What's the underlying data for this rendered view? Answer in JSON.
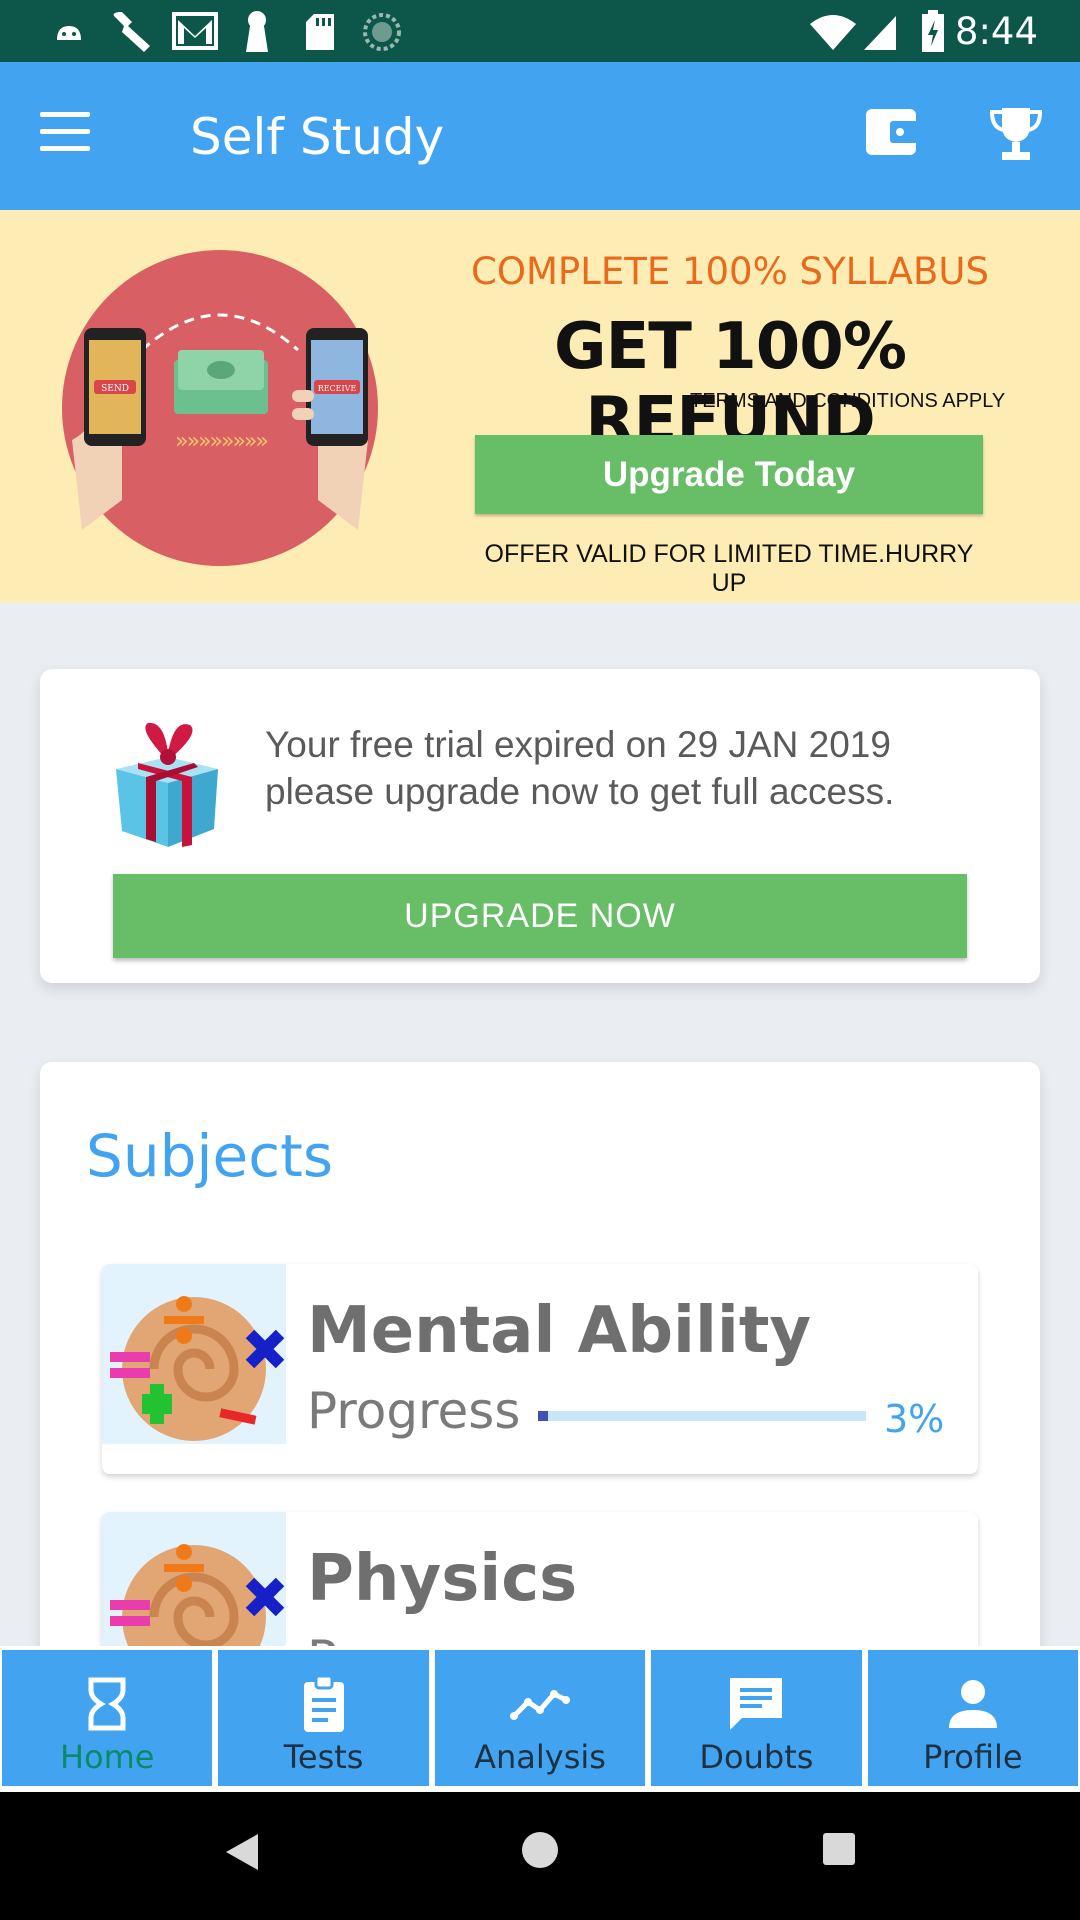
{
  "status_bar": {
    "time": "8:44",
    "icons": [
      "android-icon",
      "wrench-icon",
      "gmail-icon",
      "keyhole-icon",
      "sd-card-icon",
      "sync-icon",
      "wifi-icon",
      "signal-icon",
      "battery-charging-icon"
    ]
  },
  "app_bar": {
    "title": "Self Study",
    "menu_icon": "hamburger-menu-icon",
    "wallet_icon": "wallet-icon",
    "trophy_icon": "trophy-icon"
  },
  "promo": {
    "headline": "COMPLETE 100% SYLLABUS",
    "refund": "GET 100% REFUND",
    "terms": "TERMS AND CONDITIONS APPLY",
    "button_label": "Upgrade Today",
    "offer": "OFFER VALID FOR LIMITED TIME.HURRY UP",
    "art_send_label": "SEND",
    "art_receive_label": "RECEIVE"
  },
  "trial": {
    "message": "Your free trial expired on 29 JAN 2019 please upgrade now to get full access.",
    "button_label": "UPGRADE NOW"
  },
  "subjects": {
    "title": "Subjects",
    "items": [
      {
        "name": "Mental Ability",
        "progress_label": "Progress",
        "progress_value": 0.03,
        "progress_text": "3%"
      },
      {
        "name": "Physics",
        "progress_label": "Progress"
      }
    ]
  },
  "bottom_nav": {
    "tabs": [
      {
        "label": "Home",
        "icon": "hourglass-icon",
        "active": true
      },
      {
        "label": "Tests",
        "icon": "clipboard-icon",
        "active": false
      },
      {
        "label": "Analysis",
        "icon": "line-chart-icon",
        "active": false
      },
      {
        "label": "Doubts",
        "icon": "chat-icon",
        "active": false
      },
      {
        "label": "Profile",
        "icon": "person-icon",
        "active": false
      }
    ]
  },
  "colors": {
    "status_bar": "#0c5749",
    "app_bar": "#42a4f0",
    "promo_bg": "#fdecb4",
    "green_button": "#68bd67",
    "headline_orange": "#e86a1a",
    "active_tab_text": "#0b8a6a"
  }
}
